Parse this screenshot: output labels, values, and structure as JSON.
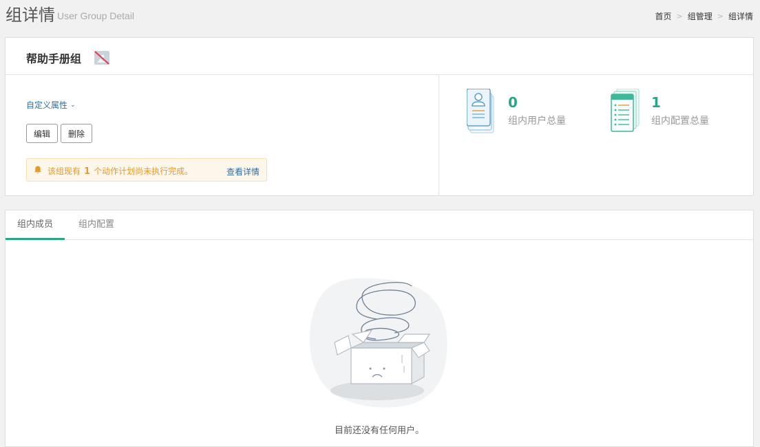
{
  "header": {
    "title": "组详情",
    "subtitle": "User Group Detail",
    "breadcrumb": [
      "首页",
      "组管理",
      "组详情"
    ]
  },
  "group": {
    "name": "帮助手册组",
    "custom_attr_label": "自定义属性",
    "edit_label": "编辑",
    "delete_label": "删除",
    "notice": {
      "prefix": "该组现有",
      "count": "1",
      "suffix": "个动作计划尚未执行完成。",
      "link": "查看详情"
    }
  },
  "stats": {
    "users": {
      "value": "0",
      "label": "组内用户总量",
      "icon": "user-card-icon"
    },
    "configs": {
      "value": "1",
      "label": "组内配置总量",
      "icon": "config-list-icon"
    }
  },
  "tabs": [
    {
      "label": "组内成员",
      "active": true
    },
    {
      "label": "组内配置",
      "active": false
    }
  ],
  "empty": {
    "message": "目前还没有任何用户。",
    "icon": "empty-box-icon"
  },
  "colors": {
    "accent": "#26a78a",
    "link": "#2d6fa6",
    "warning": "#e59a2b"
  }
}
